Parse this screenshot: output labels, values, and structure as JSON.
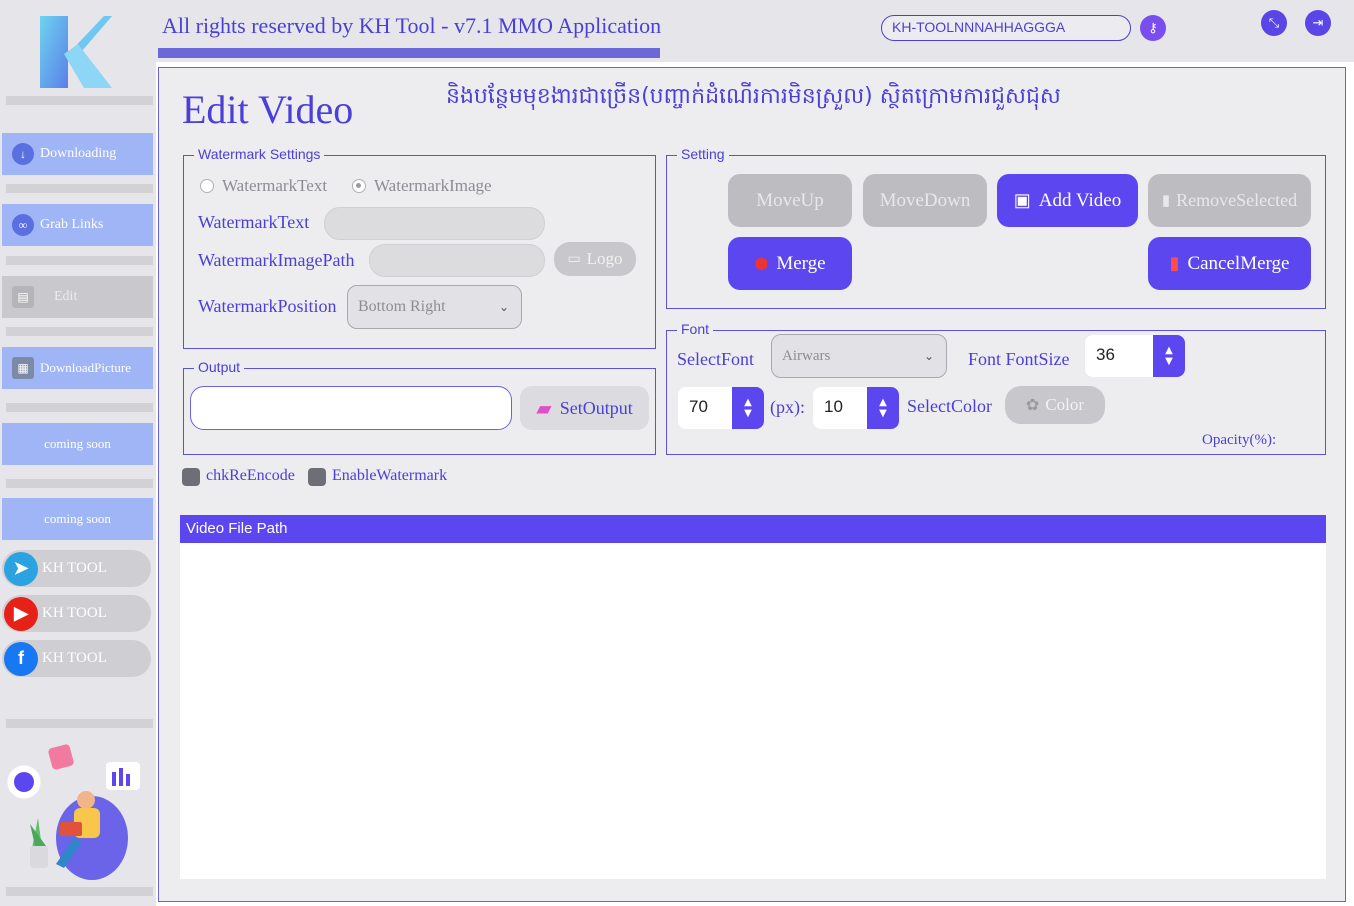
{
  "app": {
    "title": "All rights reserved by KH Tool - v7.1 MMO Application",
    "license_key": "KH-TOOLNNNAHHAGGGA"
  },
  "sidebar": {
    "items": [
      {
        "label": "Downloading",
        "state": "active"
      },
      {
        "label": "Grab Links",
        "state": "active"
      },
      {
        "label": "Edit",
        "state": "disabled"
      },
      {
        "label": "DownloadPicture",
        "state": "active"
      },
      {
        "label": "coming soon",
        "state": "active"
      },
      {
        "label": "coming soon",
        "state": "active"
      }
    ],
    "social": [
      {
        "label": "KH TOOL",
        "icon": "telegram-icon",
        "color": "#2aa3e0"
      },
      {
        "label": "KH TOOL",
        "icon": "youtube-icon",
        "color": "#e62117"
      },
      {
        "label": "KH TOOL",
        "icon": "facebook-icon",
        "color": "#1877f2"
      }
    ]
  },
  "page": {
    "title": "Edit Video",
    "note": "និងបន្ថែមមុខងារជាច្រើន(បញ្ចាក់ដំណើរការមិនស្រួល) ស្ថិតក្រោមការជួសជុស"
  },
  "watermark": {
    "legend": "Watermark Settings",
    "radio_text": "WatermarkText",
    "radio_image": "WatermarkImage",
    "selected": "WatermarkImage",
    "text_label": "WatermarkText",
    "image_label": "WatermarkImagePath",
    "logo_button": "Logo",
    "position_label": "WatermarkPosition",
    "position_value": "Bottom Right"
  },
  "output": {
    "legend": "Output",
    "set_button": "SetOutput"
  },
  "checks": {
    "reencode": "chkReEncode",
    "enable_watermark": "EnableWatermark"
  },
  "setting": {
    "legend": "Setting",
    "move_up": "MoveUp",
    "move_down": "MoveDown",
    "add_video": "Add Video",
    "remove_selected": "RemoveSelected",
    "merge": "Merge",
    "cancel_merge": "CancelMerge"
  },
  "font": {
    "legend": "Font",
    "select_label": "SelectFont",
    "font_value": "Airwars",
    "size_label": "Font FontSize",
    "font_size": "36",
    "opacity_value": "70",
    "px_label": "(px):",
    "px_value": "10",
    "color_label": "SelectColor",
    "color_button": "Color",
    "opacity_label": "Opacity(%):"
  },
  "table": {
    "header": "Video File Path"
  },
  "colors": {
    "accent": "#5b46ef",
    "text": "#4a3fd6",
    "sidebar_button": "#9fb5f5"
  }
}
